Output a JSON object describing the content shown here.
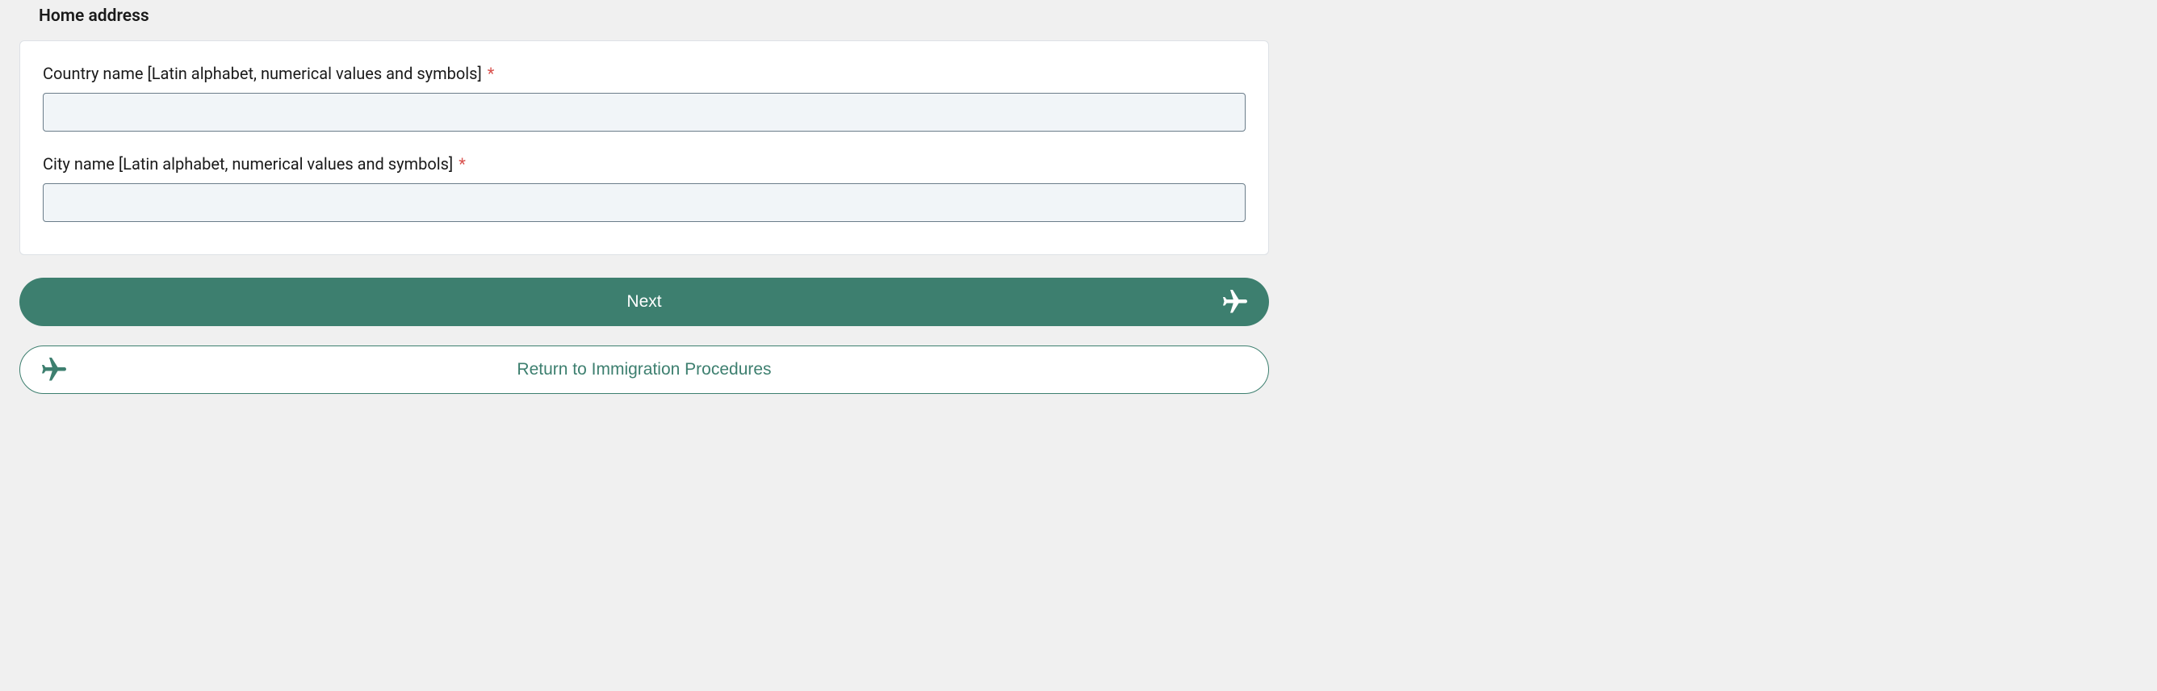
{
  "section": {
    "title": "Home address"
  },
  "fields": {
    "country": {
      "label": "Country name [Latin alphabet, numerical values and symbols]",
      "required": "*",
      "value": ""
    },
    "city": {
      "label": "City name [Latin alphabet, numerical values and symbols]",
      "required": "*",
      "value": ""
    }
  },
  "buttons": {
    "next": "Next",
    "return": "Return to Immigration Procedures"
  },
  "colors": {
    "primary": "#3d7f6f",
    "requiredMark": "#d9534f"
  }
}
